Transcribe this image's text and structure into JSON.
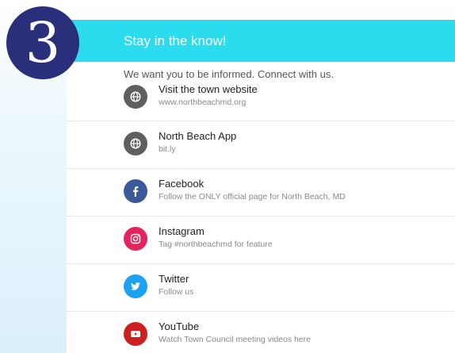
{
  "step_number": "3",
  "header": {
    "title": "Stay in the know!"
  },
  "intro_text": "We want you to be informed. Connect with us.",
  "links": [
    {
      "title": "Visit the town website",
      "subtitle": "www.northbeachmd.org",
      "icon": "globe-icon",
      "color": "#5f5f5f"
    },
    {
      "title": "North Beach App",
      "subtitle": "bit.ly",
      "icon": "globe-icon",
      "color": "#5f5f5f"
    },
    {
      "title": "Facebook",
      "subtitle": "Follow the ONLY official page for North Beach, MD",
      "icon": "facebook-icon",
      "color": "#3b5998"
    },
    {
      "title": "Instagram",
      "subtitle": "Tag #northbeachmd for feature",
      "icon": "instagram-icon",
      "color": "#e4245c"
    },
    {
      "title": "Twitter",
      "subtitle": "Follow us",
      "icon": "twitter-icon",
      "color": "#1da1f2"
    },
    {
      "title": "YouTube",
      "subtitle": "Watch Town Council meeting videos here",
      "icon": "youtube-icon",
      "color": "#cc1f1f"
    }
  ],
  "colors": {
    "header_bg": "#2adcee",
    "badge_bg": "#2a2f7c"
  }
}
